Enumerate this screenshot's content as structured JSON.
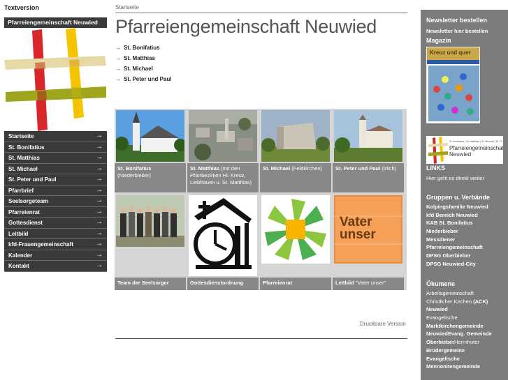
{
  "header": {
    "textversion": "Textversion",
    "breadcrumb": "Startseite",
    "title": "Pfarreiengemeinschaft Neuwied"
  },
  "sidebar": {
    "tab_label": "Pfarreiengemeinschaft Neuwied",
    "items": [
      {
        "label": "Startseite"
      },
      {
        "label": "St. Bonifatius"
      },
      {
        "label": "St. Matthias"
      },
      {
        "label": "St. Michael"
      },
      {
        "label": "St. Peter und Paul"
      },
      {
        "label": "Pfarrbrief"
      },
      {
        "label": "Seelsorgeteam"
      },
      {
        "label": "Pfarreienrat"
      },
      {
        "label": "Gottesdienst"
      },
      {
        "label": "Leitbild"
      },
      {
        "label": "kfd-Frauengemeinschaft"
      },
      {
        "label": "Kalender"
      },
      {
        "label": "Kontakt"
      }
    ],
    "arrow_glyph": "→"
  },
  "main": {
    "sub_arrow": "→",
    "sub_links": [
      "St. Bonifatius",
      "St. Matthias",
      "St. Michael",
      "St. Peter und Paul"
    ],
    "tiles": [
      {
        "bold": "St. Bonifatius",
        "rest": "(Niederbieber)"
      },
      {
        "bold": "St. Matthias",
        "rest": "(mit den Pfarrbezirken Hl. Kreuz, Liebfrauen u. St. Matthias)"
      },
      {
        "bold": "St. Michael",
        "rest": "(Feldkirchen)"
      },
      {
        "bold": "St. Peter und Paul",
        "rest": "(Irlich)"
      },
      {
        "bold": "Team der Seelsorger",
        "rest": ""
      },
      {
        "bold": "Gottesdienstordnung",
        "rest": ""
      },
      {
        "bold": "Pfarreienrat",
        "rest": ""
      },
      {
        "bold": "Leitbild",
        "rest": "\"Vater unser\""
      }
    ],
    "vater_unser_art": "Vater unser",
    "druckbare_version": "Druckbare Version"
  },
  "right": {
    "newsletter_heading": "Newsletter bestellen",
    "newsletter_link": "Newsletter hier bestellen",
    "magazin_heading": "Magazin",
    "magazin_cover_title": "Kreuz und quer",
    "neuwied_logo_text": "Pfarreiengemeinschaft Neuwied",
    "neuwied_logo_small": "St. Bonifatius | St. Matthias | St. Michael | St. Peter und Paul",
    "links_heading": "LINKS",
    "links_text": "Hier geht es direkt weiter",
    "gruppen_heading": "Gruppen u. Verbände",
    "gruppen": [
      "Kolpingsfamilie Neuwied",
      "kfd Bereich Neuwied",
      "KAB St. Bonifatius",
      "Niederbieber",
      "Messdiener",
      "Pfarreiengemeinschaft",
      "DPSG Oberbieber",
      "DPSG Neuwied-City"
    ],
    "oekumene_heading": "Ökumene",
    "oekumene": [
      {
        "parts": [
          {
            "t": "Arbeitsgemeinschaft",
            "b": false
          }
        ]
      },
      {
        "parts": [
          {
            "t": "Christlicher Kirchen ",
            "b": false
          },
          {
            "t": "(ACK)",
            "b": true
          }
        ]
      },
      {
        "parts": [
          {
            "t": "Neuwied",
            "b": true
          }
        ]
      },
      {
        "parts": [
          {
            "t": "Evangelische",
            "b": false
          }
        ]
      },
      {
        "parts": [
          {
            "t": "Marktkirchengemeinde",
            "b": true
          }
        ]
      },
      {
        "parts": [
          {
            "t": "NeuwiedEvang. Gemeinde",
            "b": true
          }
        ]
      },
      {
        "parts": [
          {
            "t": "Oberbieber",
            "b": true
          },
          {
            "t": "Herrnhuter",
            "b": false
          }
        ]
      },
      {
        "parts": [
          {
            "t": "Brüdergemeine",
            "b": true
          }
        ]
      },
      {
        "parts": [
          {
            "t": "Evangelische",
            "b": true
          }
        ]
      },
      {
        "parts": [
          {
            "t": "Mennonitengemeinde",
            "b": true
          }
        ]
      }
    ]
  },
  "colors": {
    "nav_bg": "#3a3a3a",
    "right_bg": "#7c7c7c",
    "caption_bg": "#888888",
    "logo_red": "#d9262a",
    "logo_yellow": "#f5c400",
    "logo_olive": "#9fa51c",
    "logo_beige": "#e6d9a8"
  }
}
